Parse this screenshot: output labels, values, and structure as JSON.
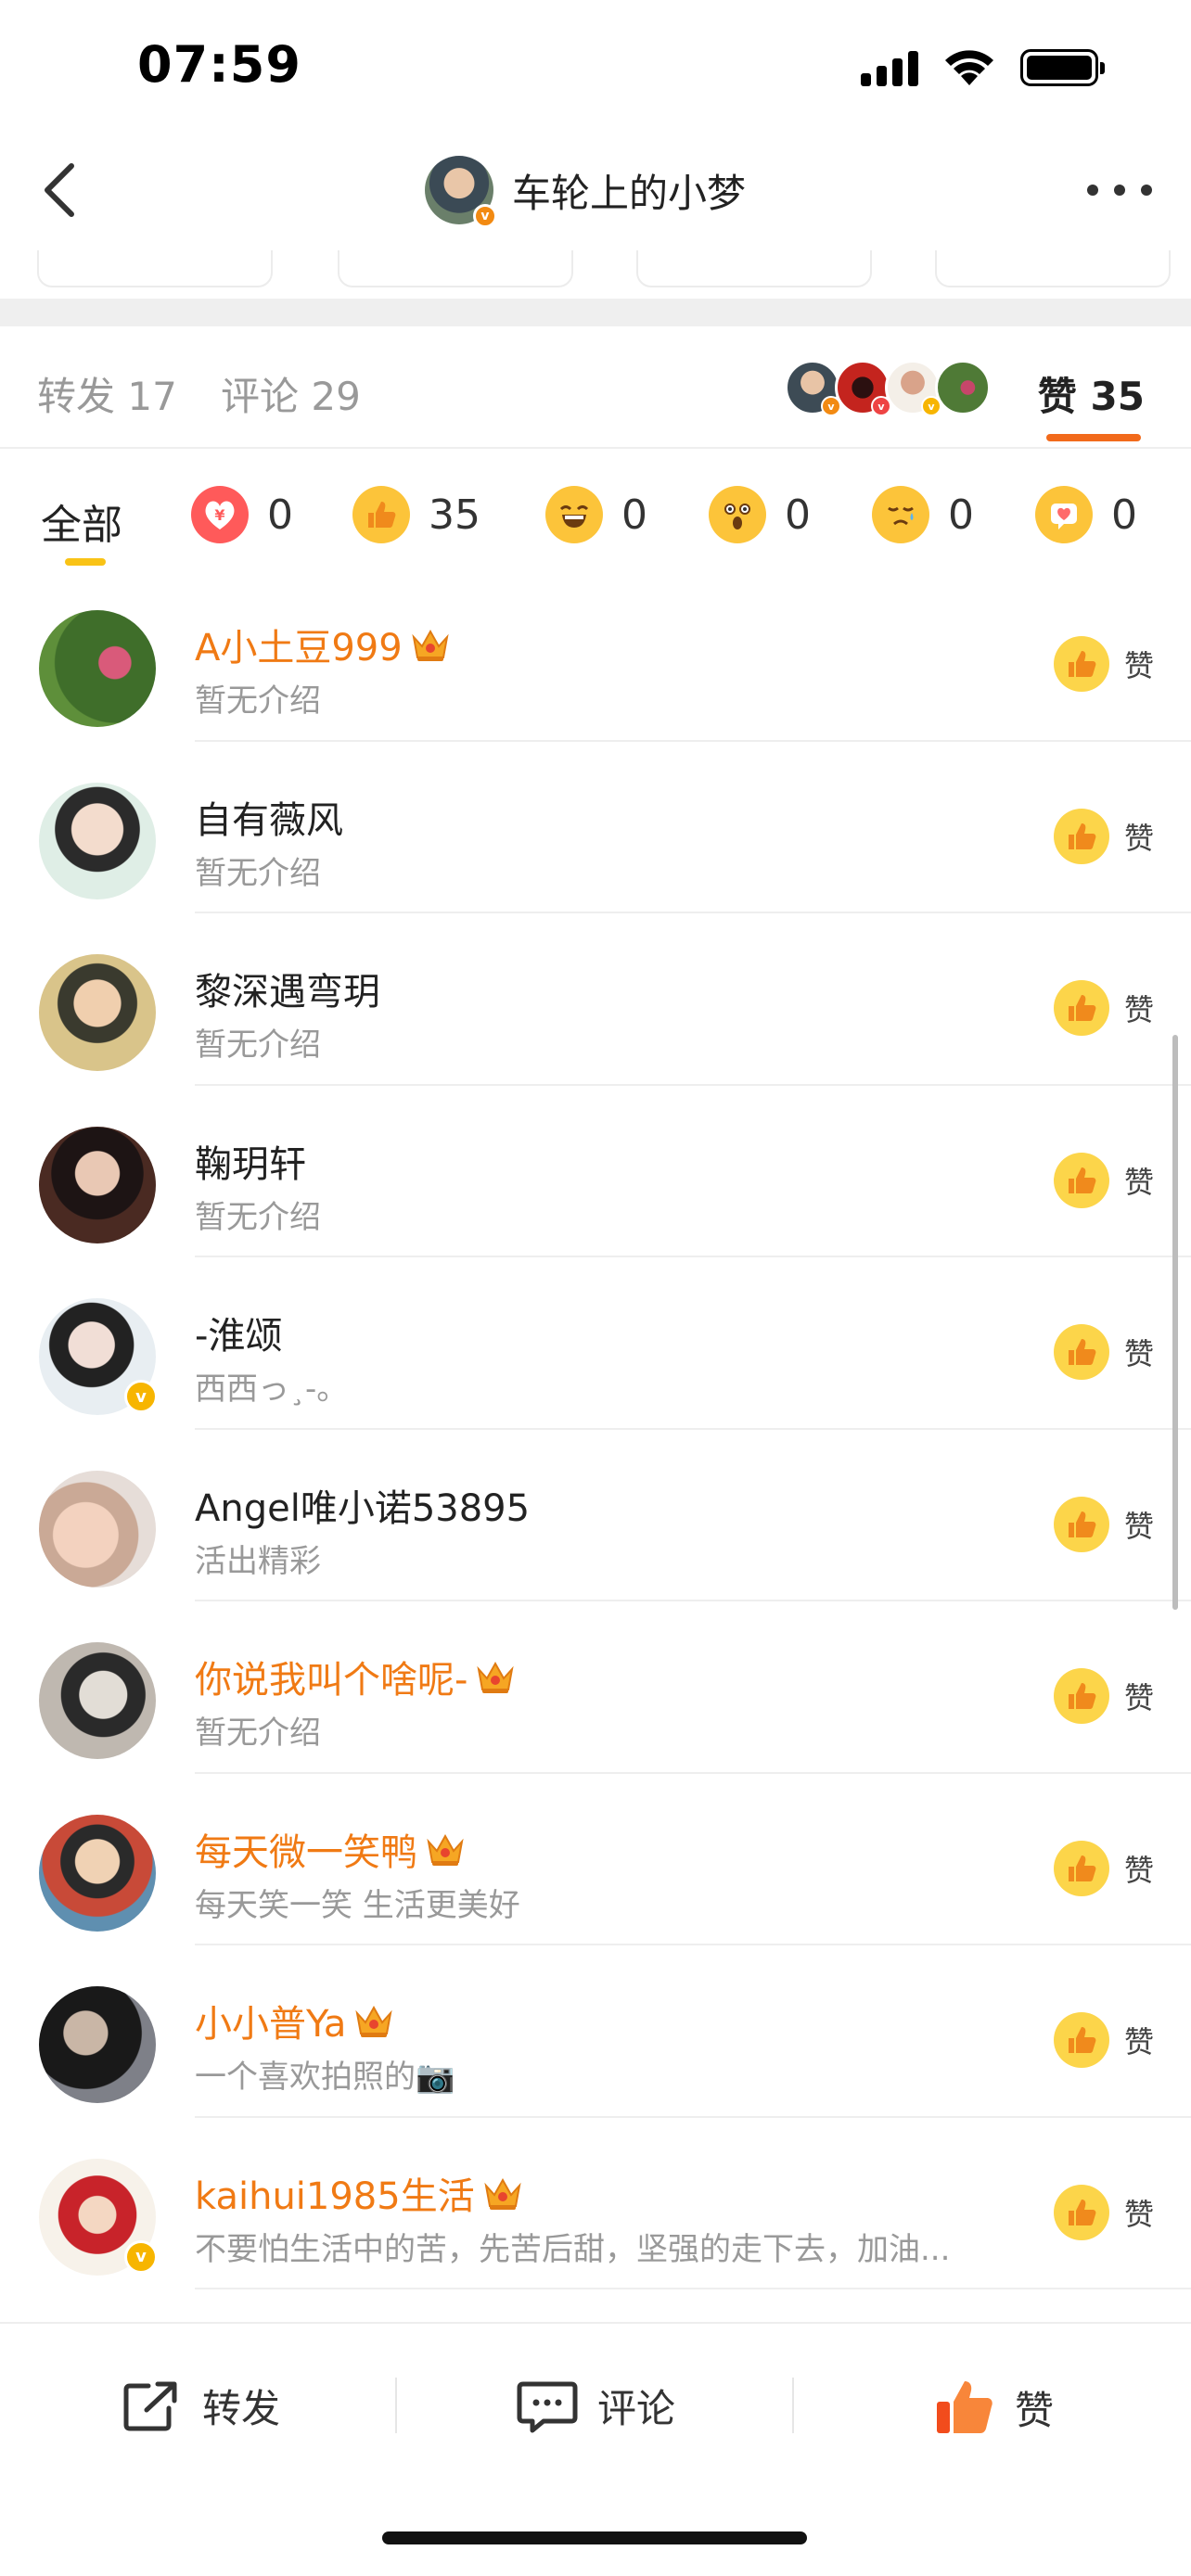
{
  "status_bar": {
    "time": "07:59"
  },
  "nav": {
    "title": "车轮上的小梦"
  },
  "tabs": {
    "forward": "转发 17",
    "comment": "评论 29",
    "like": "赞 35"
  },
  "reactions": {
    "all_label": "全部",
    "items": [
      {
        "icon": "red-envelope-icon",
        "count": "0",
        "color": "#ff5a5a"
      },
      {
        "icon": "thumbs-up-icon",
        "count": "35",
        "color": "#fcc43a"
      },
      {
        "icon": "laughing-face-icon",
        "count": "0",
        "color": "#fcc43a"
      },
      {
        "icon": "surprised-face-icon",
        "count": "0",
        "color": "#fcc43a"
      },
      {
        "icon": "sad-face-icon",
        "count": "0",
        "color": "#fcc43a"
      },
      {
        "icon": "heart-bubble-icon",
        "count": "0",
        "color": "#fcc43a"
      }
    ]
  },
  "likers": [
    {
      "name": "A小土豆999",
      "desc": "暂无介绍",
      "vip": true,
      "verified": false
    },
    {
      "name": "自有薇风",
      "desc": "暂无介绍",
      "vip": false,
      "verified": false
    },
    {
      "name": "黎深遇弯玥",
      "desc": "暂无介绍",
      "vip": false,
      "verified": false
    },
    {
      "name": "鞠玥轩",
      "desc": "暂无介绍",
      "vip": false,
      "verified": false
    },
    {
      "name": "-淮颂",
      "desc": "西西っ¸-。",
      "vip": false,
      "verified": true
    },
    {
      "name": "Angel唯小诺53895",
      "desc": "活出精彩",
      "vip": false,
      "verified": false
    },
    {
      "name": "你说我叫个啥呢-",
      "desc": "暂无介绍",
      "vip": true,
      "verified": false
    },
    {
      "name": "每天微一笑鸭",
      "desc": "每天笑一笑 生活更美好",
      "vip": true,
      "verified": false
    },
    {
      "name": "小小普Ya",
      "desc": "一个喜欢拍照的📷",
      "vip": true,
      "verified": false
    },
    {
      "name": "kaihui1985生活",
      "desc": "不要怕生活中的苦，先苦后甜，坚强的走下去，加油...",
      "vip": true,
      "verified": true
    }
  ],
  "like_button_label": "赞",
  "toolbar": {
    "forward": "转发",
    "comment": "评论",
    "like": "赞"
  },
  "colors": {
    "accent": "#f26a1b",
    "vip_name": "#f07a14",
    "like_yellow": "#fcd54a",
    "verified": "#f7b500"
  }
}
